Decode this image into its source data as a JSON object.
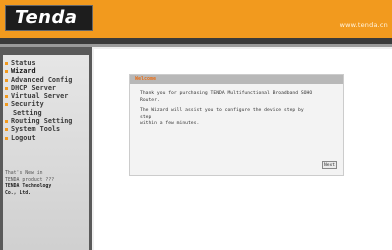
{
  "header": {
    "logo": "Tenda",
    "url": "www.tenda.cn"
  },
  "sidebar": {
    "items": [
      {
        "label": "Status"
      },
      {
        "label": "Wizard"
      },
      {
        "label": "Advanced Config"
      },
      {
        "label": "DHCP Server"
      },
      {
        "label": "Virtual Server"
      },
      {
        "label": "Security"
      },
      {
        "label": "Setting"
      },
      {
        "label": "Routing Setting"
      },
      {
        "label": "System Tools"
      },
      {
        "label": "Logout"
      }
    ],
    "note_line1": "That's New in",
    "note_line2": "TENDA product ???",
    "note_line3": "TENDA Technology",
    "note_line4": "Co., Ltd."
  },
  "panel": {
    "title": "Welcome",
    "line1": "Thank you for purchasing TENDA Multifunctional Broadband SOHO",
    "line2": "Router.",
    "line3": "The Wizard will assist you to configure the device step by step",
    "line4": "within a few minutes.",
    "next_label": "Next"
  },
  "colors": {
    "accent": "#f29a1e",
    "header_dark": "#1d1d1d",
    "sidebar_bg": "#5a5a5a",
    "title_text": "#e8701a"
  }
}
